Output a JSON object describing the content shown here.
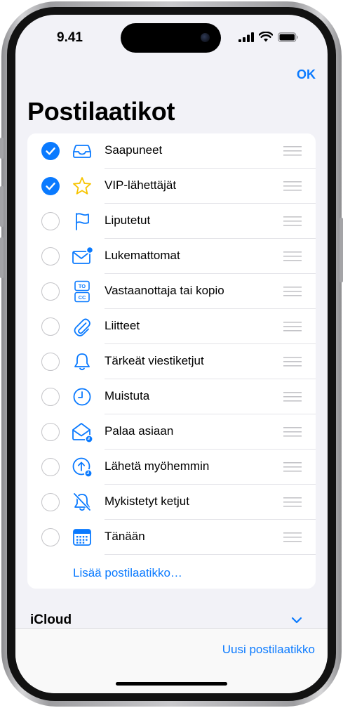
{
  "status_bar": {
    "time": "9.41"
  },
  "header": {
    "ok_label": "OK",
    "title": "Postilaatikot"
  },
  "mailboxes": [
    {
      "label": "Saapuneet",
      "checked": true,
      "icon": "inbox-tray-icon"
    },
    {
      "label": "VIP-lähettäjät",
      "checked": true,
      "icon": "star-icon"
    },
    {
      "label": "Liputetut",
      "checked": false,
      "icon": "flag-icon"
    },
    {
      "label": "Lukemattomat",
      "checked": false,
      "icon": "envelope-unread-icon"
    },
    {
      "label": "Vastaanottaja tai kopio",
      "checked": false,
      "icon": "to-cc-icon"
    },
    {
      "label": "Liitteet",
      "checked": false,
      "icon": "paperclip-icon"
    },
    {
      "label": "Tärkeät viestiketjut",
      "checked": false,
      "icon": "bell-icon"
    },
    {
      "label": "Muistuta",
      "checked": false,
      "icon": "clock-icon"
    },
    {
      "label": "Palaa asiaan",
      "checked": false,
      "icon": "envelope-follow-up-icon"
    },
    {
      "label": "Lähetä myöhemmin",
      "checked": false,
      "icon": "send-later-icon"
    },
    {
      "label": "Mykistetyt ketjut",
      "checked": false,
      "icon": "bell-slash-icon"
    },
    {
      "label": "Tänään",
      "checked": false,
      "icon": "calendar-icon"
    }
  ],
  "icon_text": {
    "to": "TO",
    "cc": "CC"
  },
  "add_mailbox_label": "Lisää postilaatikko…",
  "section": {
    "title": "iCloud"
  },
  "toolbar": {
    "new_mailbox_label": "Uusi postilaatikko"
  },
  "colors": {
    "accent": "#0a7aff",
    "background": "#f2f2f7",
    "card": "#ffffff",
    "star": "#f7c400"
  }
}
